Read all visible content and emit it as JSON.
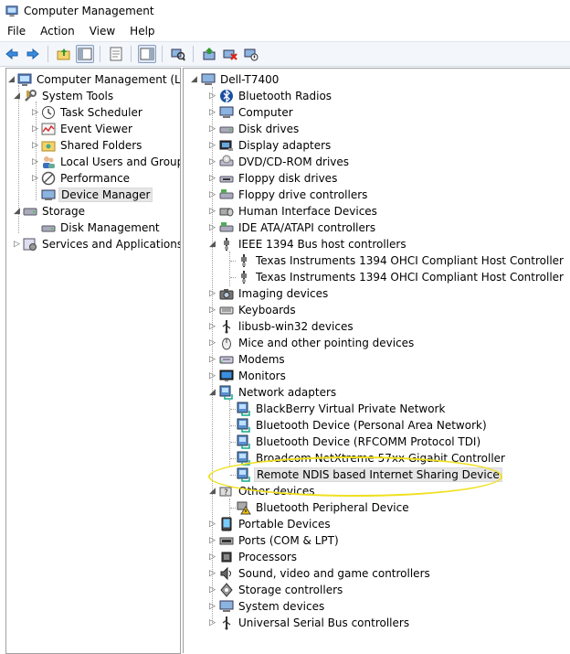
{
  "window": {
    "title": "Computer Management"
  },
  "menu": [
    "File",
    "Action",
    "View",
    "Help"
  ],
  "left_tree": {
    "root": "Computer Management (Local",
    "system_tools": "System Tools",
    "task_scheduler": "Task Scheduler",
    "event_viewer": "Event Viewer",
    "shared_folders": "Shared Folders",
    "local_users": "Local Users and Groups",
    "performance": "Performance",
    "device_manager": "Device Manager",
    "storage": "Storage",
    "disk_management": "Disk Management",
    "services": "Services and Applications"
  },
  "device_tree": {
    "root": "Dell-T7400",
    "items": [
      {
        "label": "Bluetooth Radios",
        "icon": "bluetooth-icon"
      },
      {
        "label": "Computer",
        "icon": "computer-icon"
      },
      {
        "label": "Disk drives",
        "icon": "disk-drive-icon"
      },
      {
        "label": "Display adapters",
        "icon": "display-adapter-icon"
      },
      {
        "label": "DVD/CD-ROM drives",
        "icon": "dvd-drive-icon"
      },
      {
        "label": "Floppy disk drives",
        "icon": "floppy-icon"
      },
      {
        "label": "Floppy drive controllers",
        "icon": "controller-icon"
      },
      {
        "label": "Human Interface Devices",
        "icon": "hid-icon"
      },
      {
        "label": "IDE ATA/ATAPI controllers",
        "icon": "controller-icon"
      },
      {
        "label": "IEEE 1394 Bus host controllers",
        "icon": "firewire-icon",
        "expanded": true
      },
      {
        "label": "Texas Instruments 1394 OHCI Compliant Host Controller",
        "icon": "firewire-icon",
        "child": true
      },
      {
        "label": "Texas Instruments 1394 OHCI Compliant Host Controller",
        "icon": "firewire-icon",
        "child": true
      },
      {
        "label": "Imaging devices",
        "icon": "camera-icon"
      },
      {
        "label": "Keyboards",
        "icon": "keyboard-icon"
      },
      {
        "label": "libusb-win32 devices",
        "icon": "usb-icon"
      },
      {
        "label": "Mice and other pointing devices",
        "icon": "mouse-icon"
      },
      {
        "label": "Modems",
        "icon": "modem-icon"
      },
      {
        "label": "Monitors",
        "icon": "monitor-icon"
      },
      {
        "label": "Network adapters",
        "icon": "network-icon",
        "expanded": true
      },
      {
        "label": "BlackBerry Virtual Private Network",
        "icon": "network-icon",
        "child": true
      },
      {
        "label": "Bluetooth Device (Personal Area Network)",
        "icon": "network-icon",
        "child": true
      },
      {
        "label": "Bluetooth Device (RFCOMM Protocol TDI)",
        "icon": "network-icon",
        "child": true
      },
      {
        "label": "Broadcom NetXtreme 57xx Gigabit Controller",
        "icon": "network-icon",
        "child": true
      },
      {
        "label": "Remote NDIS based Internet Sharing Device",
        "icon": "network-icon",
        "child": true,
        "selected": true
      },
      {
        "label": "Other devices",
        "icon": "unknown-device-icon",
        "expanded": true
      },
      {
        "label": "Bluetooth Peripheral Device",
        "icon": "warning-device-icon",
        "child": true
      },
      {
        "label": "Portable Devices",
        "icon": "portable-icon"
      },
      {
        "label": "Ports (COM & LPT)",
        "icon": "port-icon"
      },
      {
        "label": "Processors",
        "icon": "processor-icon"
      },
      {
        "label": "Sound, video and game controllers",
        "icon": "sound-icon"
      },
      {
        "label": "Storage controllers",
        "icon": "storage-controller-icon"
      },
      {
        "label": "System devices",
        "icon": "computer-icon"
      },
      {
        "label": "Universal Serial Bus controllers",
        "icon": "usb-icon"
      }
    ]
  },
  "colors": {
    "highlight_ellipse": "#f0e020",
    "toolbar_bg": "#f3f6fb"
  }
}
